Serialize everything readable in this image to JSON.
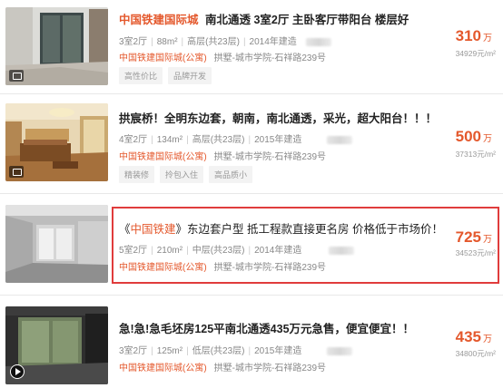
{
  "listings": [
    {
      "title_prefix": "中国铁建国际城",
      "title_rest": "南北通透 3室2厅 主卧客厅带阳台 楼层好",
      "layout": "3室2厅",
      "area": "88m²",
      "floor": "高层(共23层)",
      "built": "2014年建造",
      "community": "中国铁建国际城(公寓)",
      "location": "拱墅-城市学院-石祥路239号",
      "tags": [
        "高性价比",
        "品牌开发"
      ],
      "price": "310",
      "price_unit": "万",
      "unit_price": "34929元/m²",
      "media_icon": "photo-icon"
    },
    {
      "title_prefix": "",
      "title_rest": "拱宸桥！全明东边套，朝南，南北通透，采光，超大阳台！！！",
      "layout": "4室2厅",
      "area": "134m²",
      "floor": "高层(共23层)",
      "built": "2015年建造",
      "community": "中国铁建国际城(公寓)",
      "location": "拱墅-城市学院-石祥路239号",
      "tags": [
        "精装修",
        "拎包入住",
        "高品质小"
      ],
      "price": "500",
      "price_unit": "万",
      "unit_price": "37313元/m²",
      "media_icon": "photo-icon"
    },
    {
      "title_open": "《",
      "title_prefix": "中国铁建",
      "title_rest": "》东边套户型 抵工程款直接更名房 价格低于市场价！",
      "layout": "5室2厅",
      "area": "210m²",
      "floor": "中层(共23层)",
      "built": "2014年建造",
      "community": "中国铁建国际城(公寓)",
      "location": "拱墅-城市学院-石祥路239号",
      "tags": [],
      "price": "725",
      "price_unit": "万",
      "unit_price": "34523元/m²",
      "media_icon": ""
    },
    {
      "title_prefix": "",
      "title_rest": "急!急!急毛坯房125平南北通透435万元急售，便宜便宜！！",
      "layout": "3室2厅",
      "area": "125m²",
      "floor": "低层(共23层)",
      "built": "2015年建造",
      "community": "中国铁建国际城(公寓)",
      "location": "拱墅-城市学院-石祥路239号",
      "tags": [],
      "price": "435",
      "price_unit": "万",
      "unit_price": "34800元/m²",
      "media_icon": "video-play-icon"
    }
  ],
  "colors": {
    "accent": "#e4582c",
    "highlight_border": "#e03c3c",
    "tag_bg": "#f3f3f3",
    "muted_text": "#888888"
  }
}
